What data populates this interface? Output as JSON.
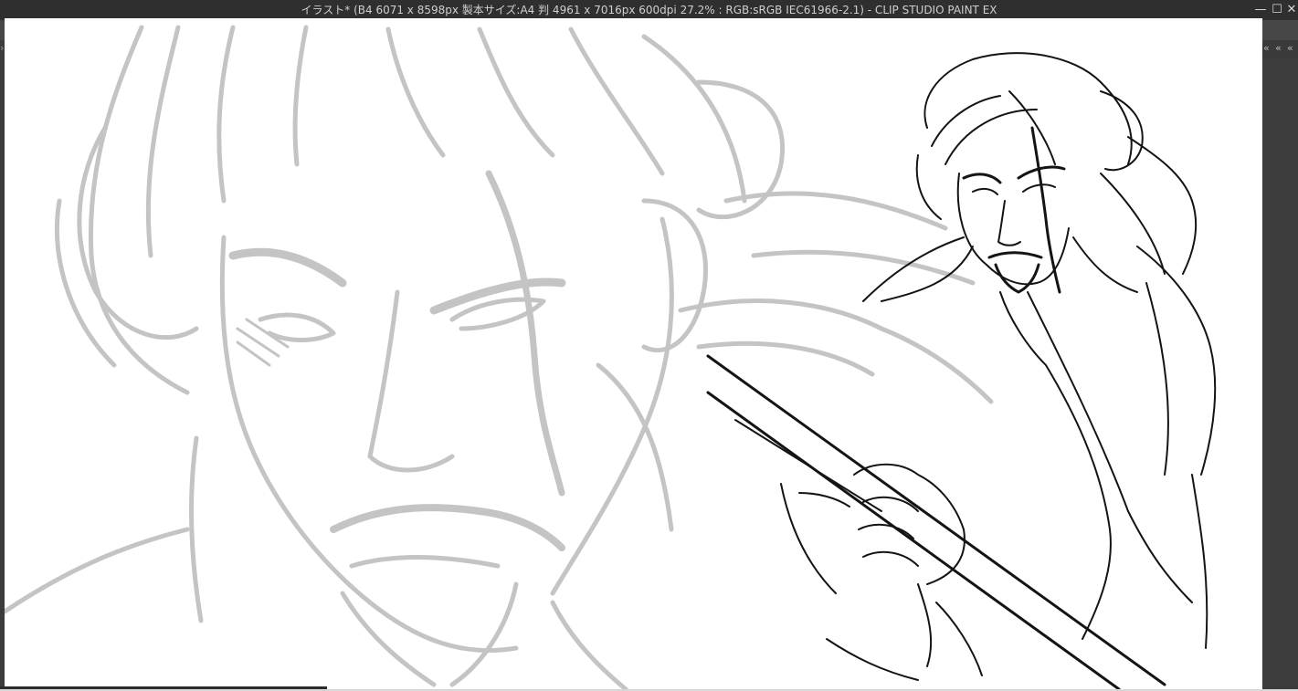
{
  "window": {
    "title": "イラスト* (B4 6071 x 8598px 製本サイズ:A4 判 4961 x 7016px 600dpi 27.2% : RGB:sRGB IEC61966-2.1)  - CLIP STUDIO PAINT EX",
    "minimize_glyph": "—",
    "maximize_glyph": "☐",
    "close_glyph": "✕"
  },
  "panel_controls": {
    "chevron_down": "⌄",
    "collapse": "«"
  },
  "canvas": {
    "zoom_percent": 27.2,
    "background": "#ffffff",
    "sketch_color": "#c4c4c4",
    "ink_color": "#141414"
  },
  "colors": {
    "titlebar_bg": "#2f2f2f",
    "app_bg": "#3c3c3c",
    "title_text": "#cfcfcf"
  }
}
